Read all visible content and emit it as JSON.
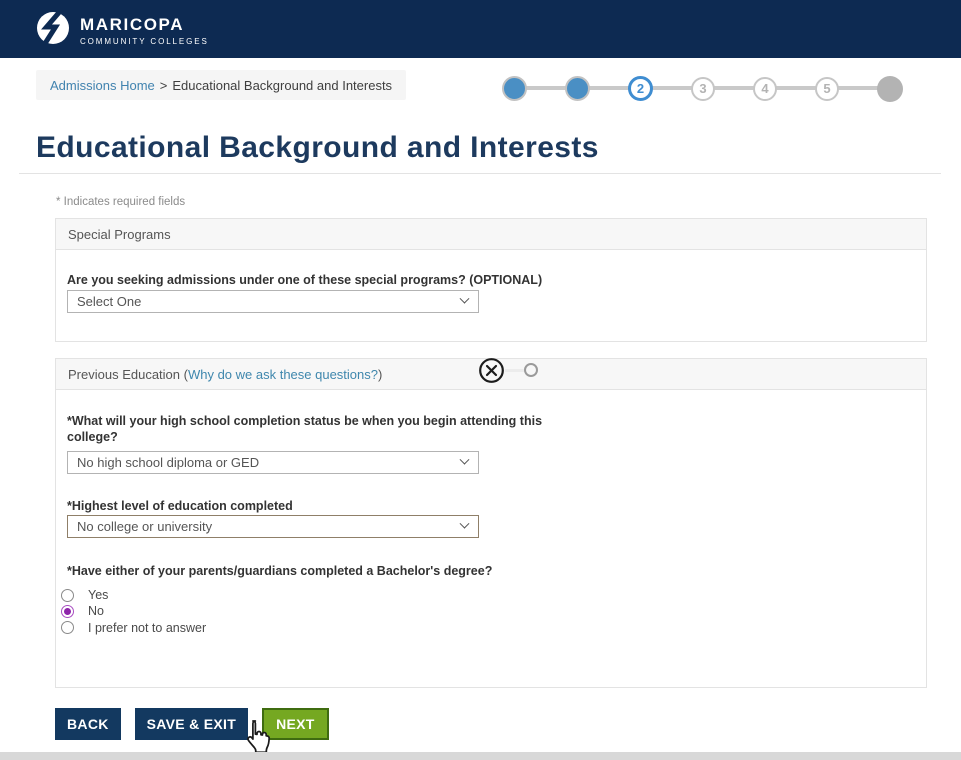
{
  "brand": {
    "name": "MARICOPA",
    "tagline": "COMMUNITY COLLEGES"
  },
  "breadcrumb": {
    "home_link": "Admissions Home",
    "separator": ">",
    "current_page": "Educational Background and Interests"
  },
  "stepper": {
    "steps": [
      {
        "label": "",
        "state": "done"
      },
      {
        "label": "",
        "state": "done"
      },
      {
        "label": "2",
        "state": "current"
      },
      {
        "label": "3",
        "state": "upcoming"
      },
      {
        "label": "4",
        "state": "upcoming"
      },
      {
        "label": "5",
        "state": "upcoming"
      },
      {
        "label": "",
        "state": "end"
      }
    ]
  },
  "page": {
    "title": "Educational Background and Interests",
    "required_note": "* Indicates required fields"
  },
  "special_programs": {
    "header": "Special Programs",
    "question": "Are you seeking admissions under one of these special programs? (OPTIONAL)",
    "selected_value": "Select One"
  },
  "previous_education": {
    "header_prefix": "Previous Education (",
    "header_link": "Why do we ask these questions?",
    "header_suffix": ")",
    "hs_question": "*What will your high school completion status be when you begin attending this college?",
    "hs_selected_value": "No high school diploma or GED",
    "highest_level_question": "*Highest level of education completed",
    "highest_level_selected_value": "No college or university",
    "parents_question": "*Have either of your parents/guardians completed a Bachelor's degree?",
    "parents_options": [
      {
        "label": "Yes",
        "selected": false
      },
      {
        "label": "No",
        "selected": true
      },
      {
        "label": "I prefer not to answer",
        "selected": false
      }
    ]
  },
  "actions": {
    "back": "BACK",
    "save_exit": "SAVE & EXIT",
    "next": "NEXT"
  },
  "colors": {
    "header_navy": "#0d2a52",
    "title_navy": "#1d3a5e",
    "link_blue": "#4183af",
    "step_blue": "#4a8fc4",
    "button_navy": "#133960",
    "button_green": "#75a821",
    "radio_purple": "#8e24aa"
  }
}
